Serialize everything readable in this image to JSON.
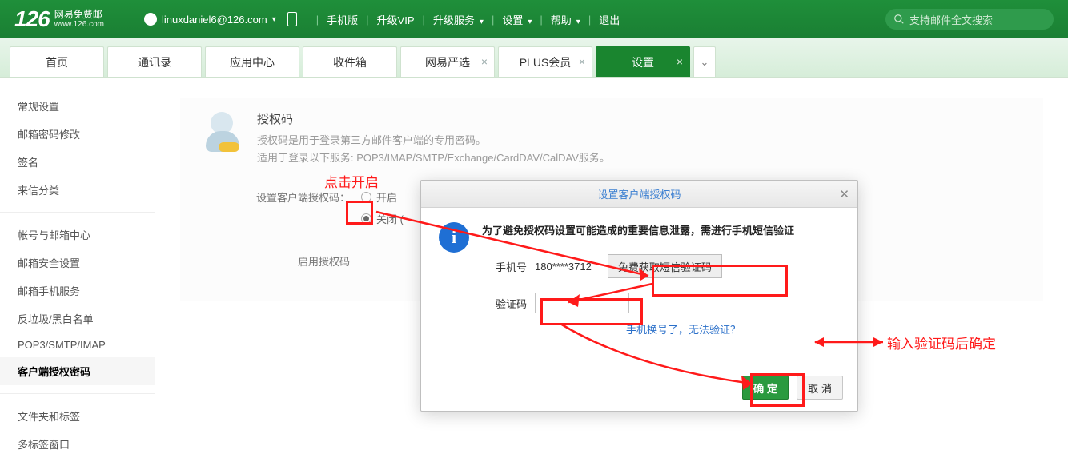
{
  "brand": {
    "logo": "126",
    "title": "网易免费邮",
    "domain": "www.126.com"
  },
  "account": {
    "email": "linuxdaniel6@126.com"
  },
  "topmenu": {
    "mobile": "手机版",
    "vip": "升级VIP",
    "upgrade": "升级服务",
    "settings": "设置",
    "help": "帮助",
    "logout": "退出"
  },
  "search": {
    "placeholder": "支持邮件全文搜索"
  },
  "tabs": [
    {
      "label": "首页",
      "closable": false
    },
    {
      "label": "通讯录",
      "closable": false
    },
    {
      "label": "应用中心",
      "closable": false
    },
    {
      "label": "收件箱",
      "closable": false
    },
    {
      "label": "网易严选",
      "closable": true
    },
    {
      "label": "PLUS会员",
      "closable": true
    },
    {
      "label": "设置",
      "closable": true,
      "active": true
    }
  ],
  "sidebar": {
    "items": [
      "常规设置",
      "邮箱密码修改",
      "签名",
      "来信分类",
      "帐号与邮箱中心",
      "邮箱安全设置",
      "邮箱手机服务",
      "反垃圾/黑白名单",
      "POP3/SMTP/IMAP",
      "客户端授权密码",
      "文件夹和标签",
      "多标签窗口"
    ],
    "currentIndex": 9,
    "dividers_after": [
      3,
      9
    ]
  },
  "panel": {
    "title": "授权码",
    "desc1": "授权码是用于登录第三方邮件客户端的专用密码。",
    "desc2": "适用于登录以下服务: POP3/IMAP/SMTP/Exchange/CardDAV/CalDAV服务。"
  },
  "form": {
    "set_label": "设置客户端授权码：",
    "opt_open": "开启",
    "opt_close": "关闭 (",
    "enable_label": "启用授权码"
  },
  "modal": {
    "title": "设置客户端授权码",
    "body": "为了避免授权码设置可能造成的重要信息泄露，需进行手机短信验证",
    "phone_label": "手机号",
    "phone_value": "180****3712",
    "sms_button": "免费获取短信验证码",
    "code_label": "验证码",
    "help_link": "手机换号了，无法验证？",
    "ok": "确 定",
    "cancel": "取 消"
  },
  "annotations": {
    "click_open": "点击开启",
    "confirm": "输入验证码后确定"
  }
}
